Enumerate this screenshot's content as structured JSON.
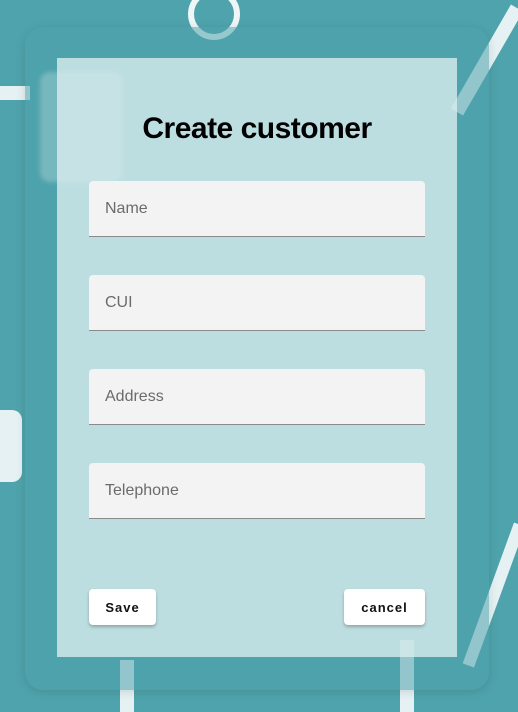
{
  "form": {
    "title": "Create customer",
    "fields": [
      {
        "placeholder": "Name",
        "value": ""
      },
      {
        "placeholder": "CUI",
        "value": ""
      },
      {
        "placeholder": "Address",
        "value": ""
      },
      {
        "placeholder": "Telephone",
        "value": ""
      }
    ],
    "save_label": "Save",
    "cancel_label": "cancel"
  },
  "colors": {
    "background": "#4fa3ac",
    "card": "#dceef0",
    "field": "#f3f3f3"
  }
}
